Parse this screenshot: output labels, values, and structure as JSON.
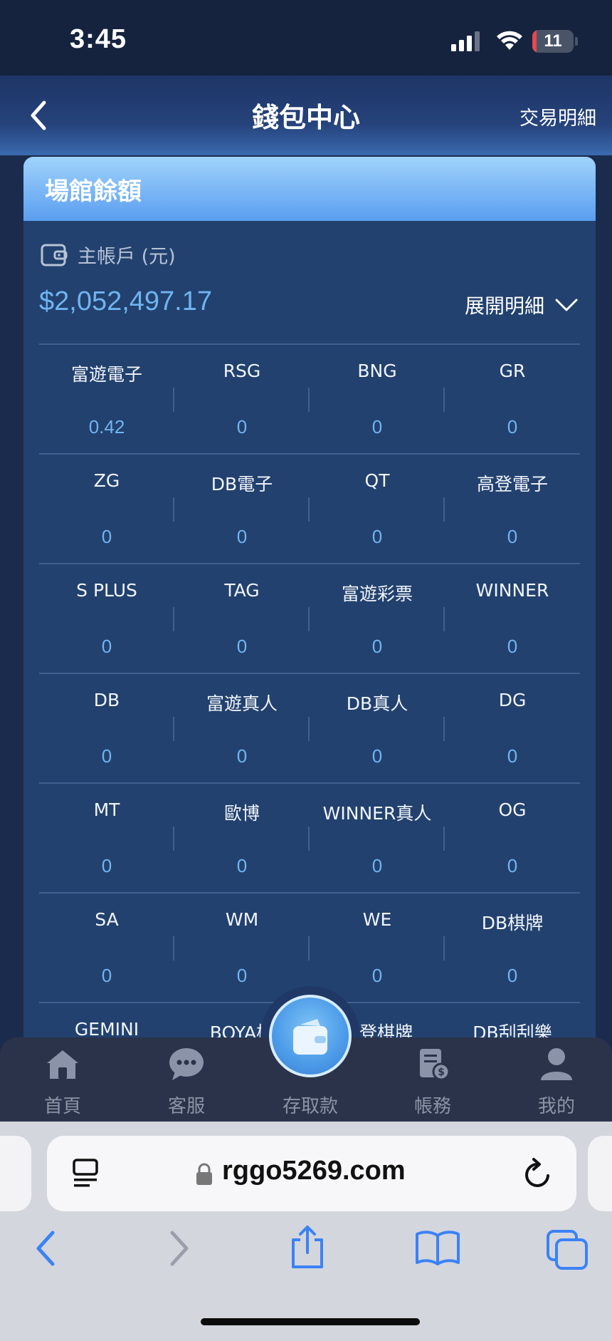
{
  "status_bar": {
    "time": "3:45",
    "battery": "11",
    "battery_level": 0.11
  },
  "header": {
    "title": "錢包中心",
    "right_link": "交易明細"
  },
  "card": {
    "title": "場館餘額",
    "account_label": "主帳戶 (元)",
    "balance": "$2,052,497.17",
    "expand_label": "展開明細"
  },
  "venues": [
    [
      {
        "name": "富遊電子",
        "value": "0.42"
      },
      {
        "name": "RSG",
        "value": "0"
      },
      {
        "name": "BNG",
        "value": "0"
      },
      {
        "name": "GR",
        "value": "0"
      }
    ],
    [
      {
        "name": "ZG",
        "value": "0"
      },
      {
        "name": "DB電子",
        "value": "0"
      },
      {
        "name": "QT",
        "value": "0"
      },
      {
        "name": "高登電子",
        "value": "0"
      }
    ],
    [
      {
        "name": "S PLUS",
        "value": "0"
      },
      {
        "name": "TAG",
        "value": "0"
      },
      {
        "name": "富遊彩票",
        "value": "0"
      },
      {
        "name": "WINNER",
        "value": "0"
      }
    ],
    [
      {
        "name": "DB",
        "value": "0"
      },
      {
        "name": "富遊真人",
        "value": "0"
      },
      {
        "name": "DB真人",
        "value": "0"
      },
      {
        "name": "DG",
        "value": "0"
      }
    ],
    [
      {
        "name": "MT",
        "value": "0"
      },
      {
        "name": "歐博",
        "value": "0"
      },
      {
        "name": "WINNER真人",
        "value": "0"
      },
      {
        "name": "OG",
        "value": "0"
      }
    ],
    [
      {
        "name": "SA",
        "value": "0"
      },
      {
        "name": "WM",
        "value": "0"
      },
      {
        "name": "WE",
        "value": "0"
      },
      {
        "name": "DB棋牌",
        "value": "0"
      }
    ],
    [
      {
        "name": "GEMINI",
        "value": ""
      },
      {
        "name": "BOYA棋",
        "value": ""
      },
      {
        "name": "高登棋牌",
        "value": ""
      },
      {
        "name": "DB刮刮樂",
        "value": ""
      }
    ]
  ],
  "bottom_nav": {
    "home": "首頁",
    "service": "客服",
    "deposit": "存取款",
    "account": "帳務",
    "mine": "我的"
  },
  "browser": {
    "url": "rggo5269.com"
  },
  "colors": {
    "accent": "#6fb4f1",
    "card_bg": "#22416e",
    "header_gradient_bottom": "#5b9ef0"
  }
}
